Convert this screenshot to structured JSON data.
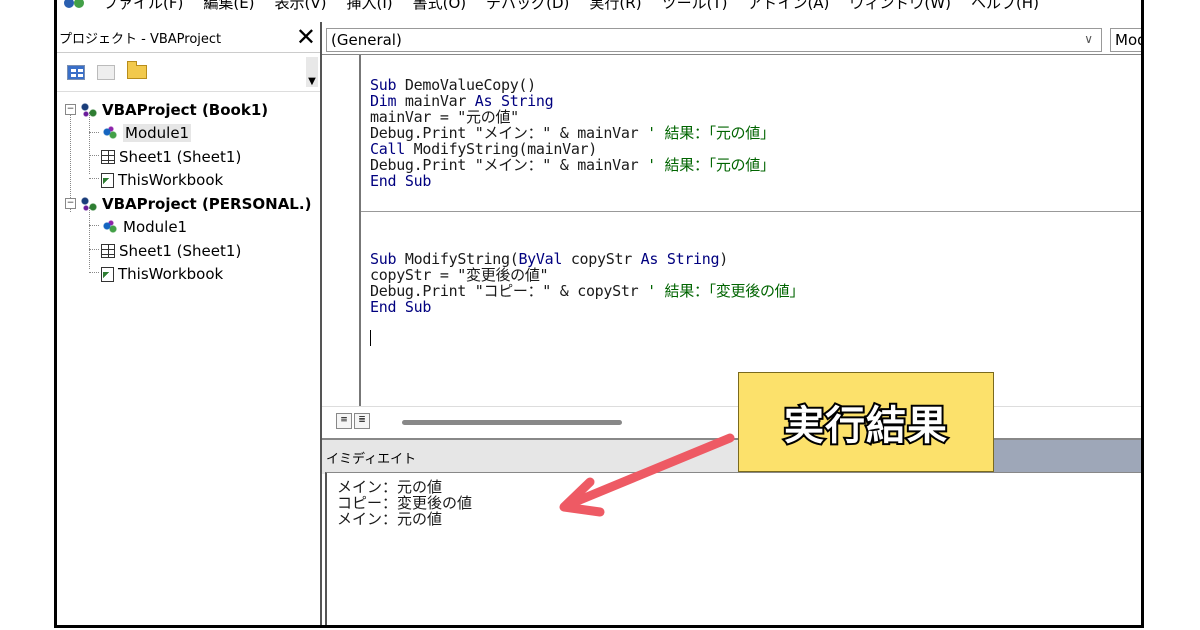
{
  "menubar": {
    "items": [
      "ファイル(F)",
      "編集(E)",
      "表示(V)",
      "挿入(I)",
      "書式(O)",
      "デバッグ(D)",
      "実行(R)",
      "ツール(T)",
      "アドイン(A)",
      "ウィンドウ(W)",
      "ヘルプ(H)"
    ]
  },
  "project": {
    "title": "プロジェクト - VBAProject",
    "tree": [
      {
        "label": "VBAProject (Book1)"
      },
      {
        "label": "Module1"
      },
      {
        "label": "Sheet1 (Sheet1)"
      },
      {
        "label": "ThisWorkbook"
      },
      {
        "label": "VBAProject (PERSONAL.)"
      },
      {
        "label": "Module1"
      },
      {
        "label": "Sheet1 (Sheet1)"
      },
      {
        "label": "ThisWorkbook"
      }
    ]
  },
  "code_window": {
    "object_combo": "(General)",
    "proc_combo": "Mod"
  },
  "immediate": {
    "title": "イミディエイト",
    "output": [
      "メイン：元の値",
      "コピー：変更後の値",
      "メイン：元の値"
    ]
  },
  "annotation": {
    "label": "実行結果",
    "box_color": "#fce16b",
    "arrow_color": "#ee5a64"
  }
}
